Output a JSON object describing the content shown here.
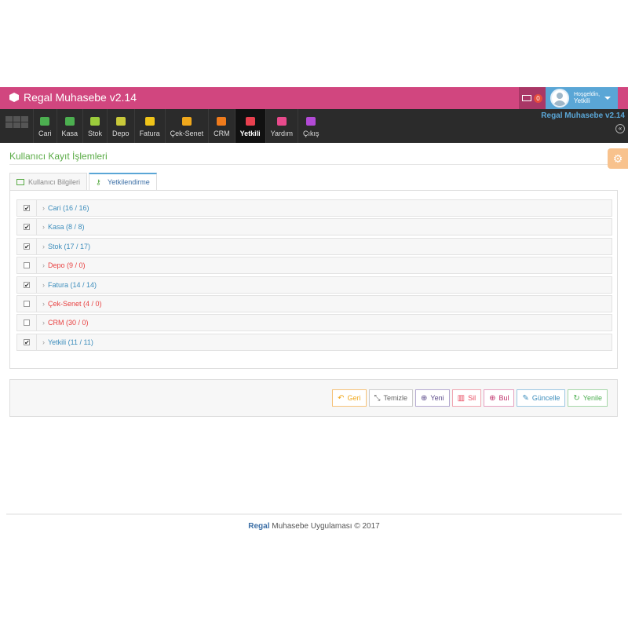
{
  "header": {
    "brand": "Regal Muhasebe v2.14",
    "messages_count": "0",
    "greeting": "Hoşgeldin,",
    "username": "Yetkili"
  },
  "nav": {
    "items": [
      {
        "label": "Cari",
        "icon": "user-plus-icon",
        "color": "#4caf50"
      },
      {
        "label": "Kasa",
        "icon": "briefcase-icon",
        "color": "#4caf50"
      },
      {
        "label": "Stok",
        "icon": "cubes-icon",
        "color": "#9ccc3c"
      },
      {
        "label": "Depo",
        "icon": "warehouse-icon",
        "color": "#c9c93a"
      },
      {
        "label": "Fatura",
        "icon": "file-text-icon",
        "color": "#f0c419"
      },
      {
        "label": "Çek-Senet",
        "icon": "money-icon",
        "color": "#f0a81c"
      },
      {
        "label": "CRM",
        "icon": "users-icon",
        "color": "#f07b1c"
      },
      {
        "label": "Yetkili",
        "icon": "cogs-icon",
        "color": "#e8404f"
      },
      {
        "label": "Yardım",
        "icon": "handshake-icon",
        "color": "#e84a8c"
      },
      {
        "label": "Çıkış",
        "icon": "power-icon",
        "color": "#b24ad6"
      }
    ],
    "active_index": 7,
    "right_title": "Regal Muhasebe v2.14",
    "collapse_glyph": "«"
  },
  "page": {
    "title": "Kullanıcı Kayıt İşlemleri",
    "tabs": [
      {
        "label": "Kullanıcı Bilgileri",
        "active": false
      },
      {
        "label": "Yetkilendirme",
        "active": true
      }
    ]
  },
  "permissions": [
    {
      "label": "Cari (16 / 16)",
      "checked": true,
      "color": "#3c8dbc"
    },
    {
      "label": "Kasa (8 / 8)",
      "checked": true,
      "color": "#3c8dbc"
    },
    {
      "label": "Stok (17 / 17)",
      "checked": true,
      "color": "#3c8dbc"
    },
    {
      "label": "Depo (9 / 0)",
      "checked": false,
      "color": "#e84040"
    },
    {
      "label": "Fatura (14 / 14)",
      "checked": true,
      "color": "#3c8dbc"
    },
    {
      "label": "Çek-Senet (4 / 0)",
      "checked": false,
      "color": "#e84040"
    },
    {
      "label": "CRM (30 / 0)",
      "checked": false,
      "color": "#e84040"
    },
    {
      "label": "Yetkili (11 / 11)",
      "checked": true,
      "color": "#3c8dbc"
    }
  ],
  "actions": [
    {
      "label": "Geri",
      "icon": "undo-icon",
      "glyph": "↶",
      "color": "#f0a81c",
      "border": "#f5c27a"
    },
    {
      "label": "Temizle",
      "icon": "compress-icon",
      "glyph": "⤡",
      "color": "#666666",
      "border": "#cccccc"
    },
    {
      "label": "Yeni",
      "icon": "plus-circle-icon",
      "glyph": "⊕",
      "color": "#5b4a8a",
      "border": "#b3a8cf"
    },
    {
      "label": "Sil",
      "icon": "trash-icon",
      "glyph": "▥",
      "color": "#e84a5f",
      "border": "#f0a5b0"
    },
    {
      "label": "Bul",
      "icon": "search-plus-icon",
      "glyph": "⊕",
      "color": "#c0306a",
      "border": "#e5a0bf"
    },
    {
      "label": "Güncelle",
      "icon": "edit-icon",
      "glyph": "✎",
      "color": "#3c8dbc",
      "border": "#9cc7e2"
    },
    {
      "label": "Yenile",
      "icon": "refresh-icon",
      "glyph": "↻",
      "color": "#4caf50",
      "border": "#a5d6a7"
    }
  ],
  "footer": {
    "brand": "Regal",
    "text": " Muhasebe Uygulaması © 2017"
  }
}
